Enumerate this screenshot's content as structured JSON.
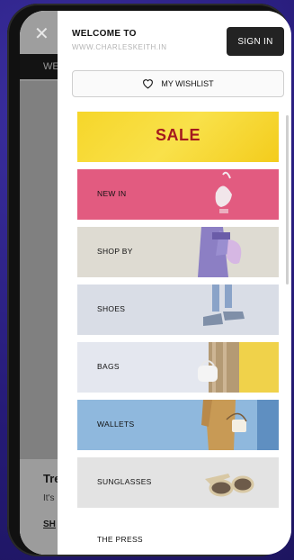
{
  "drawer": {
    "welcome_title": "WELCOME TO",
    "site_name": "WWW.CHARLESKEITH.IN",
    "sign_in_label": "SIGN IN",
    "wishlist_label": "MY WISHLIST"
  },
  "menu": [
    {
      "label": "SALE"
    },
    {
      "label": "NEW IN"
    },
    {
      "label": "SHOP BY"
    },
    {
      "label": "SHOES"
    },
    {
      "label": "BAGS"
    },
    {
      "label": "WALLETS"
    },
    {
      "label": "SUNGLASSES"
    },
    {
      "label": "THE PRESS"
    }
  ],
  "background_page": {
    "nav_fragment": "WE",
    "heading_fragment": "Tre",
    "text_fragment": "It's",
    "link_fragment": "SH"
  },
  "icons": {
    "close": "close-icon",
    "wishlist": "heart-icon"
  },
  "colors": {
    "sale_text": "#a4191f",
    "sale_bg": "#f6d62a",
    "new_in_bg": "#e25b80",
    "sign_in_bg": "#232323",
    "wallets_bg": "#8fb8dd"
  }
}
